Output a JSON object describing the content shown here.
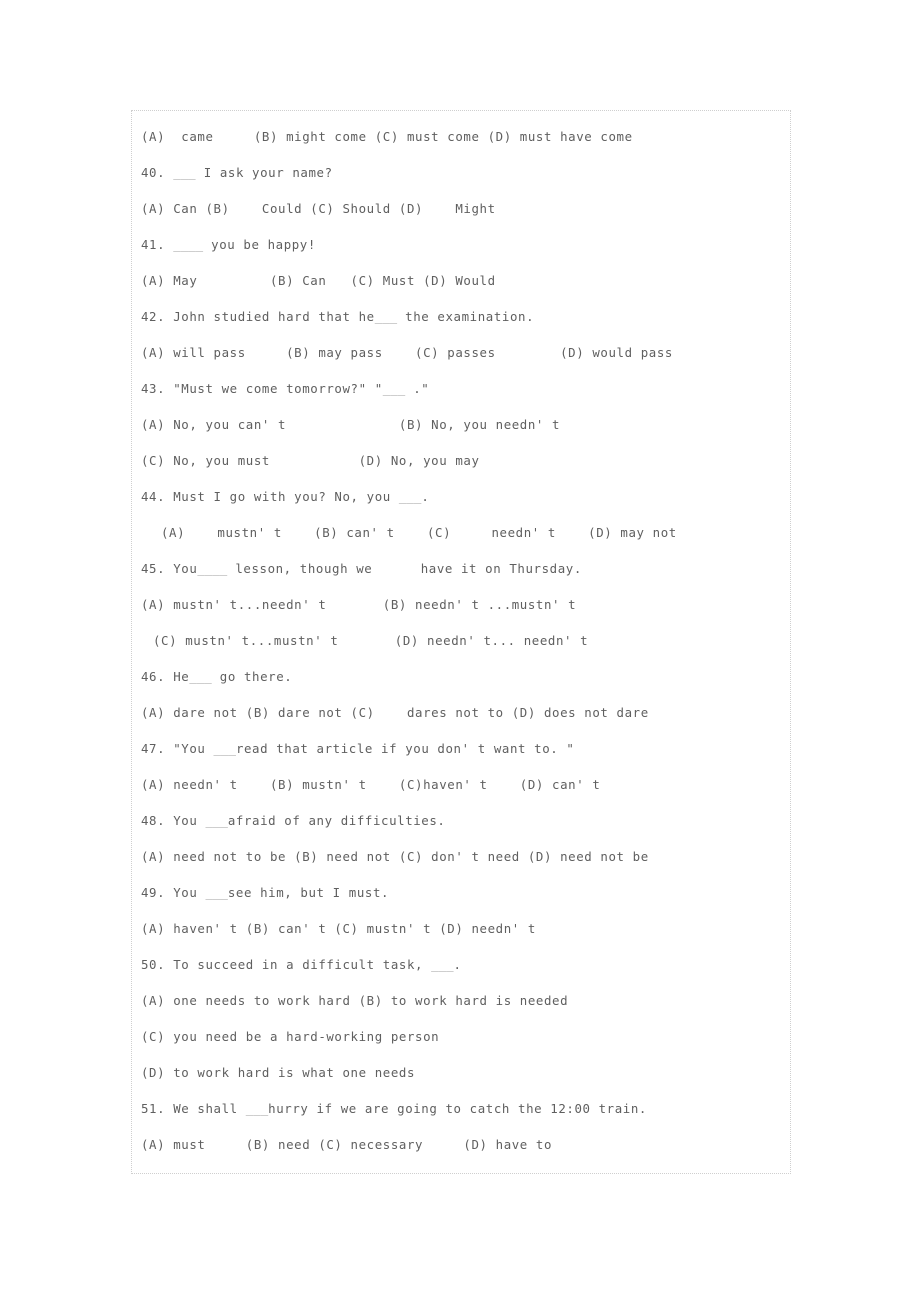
{
  "document": {
    "type": "exam-worksheet",
    "subject": "English grammar multiple choice (modal verbs)",
    "text_color": "#5f5f5f",
    "border_color": "#cfcfcf",
    "background": "#ffffff"
  },
  "lines": [
    {
      "id": "l01",
      "kind": "options",
      "indent": 0,
      "text": "(A)  came     (B) might come (C) must come (D) must have come"
    },
    {
      "id": "l02",
      "kind": "question",
      "indent": 0,
      "text": "40. ___ I ask your name?"
    },
    {
      "id": "l03",
      "kind": "options",
      "indent": 0,
      "text": "(A) Can (B)    Could (C) Should (D)    Might"
    },
    {
      "id": "l04",
      "kind": "question",
      "indent": 0,
      "text": "41. ____ you be happy!"
    },
    {
      "id": "l05",
      "kind": "options",
      "indent": 0,
      "text": "(A) May         (B) Can   (C) Must (D) Would"
    },
    {
      "id": "l06",
      "kind": "question",
      "indent": 0,
      "text": "42. John studied hard that he___ the examination."
    },
    {
      "id": "l07",
      "kind": "options",
      "indent": 0,
      "text": "(A) will pass     (B) may pass    (C) passes        (D) would pass"
    },
    {
      "id": "l08",
      "kind": "question",
      "indent": 0,
      "text": "43. \"Must we come tomorrow?\" \"___ .\""
    },
    {
      "id": "l09",
      "kind": "options",
      "indent": 0,
      "text": "(A) No, you can' t              (B) No, you needn' t"
    },
    {
      "id": "l10",
      "kind": "options",
      "indent": 0,
      "text": "(C) No, you must           (D) No, you may"
    },
    {
      "id": "l11",
      "kind": "question",
      "indent": 0,
      "text": "44. Must I go with you? No, you ___."
    },
    {
      "id": "l12",
      "kind": "options",
      "indent": 1,
      "text": "(A)    mustn' t    (B) can' t    (C)     needn' t    (D) may not"
    },
    {
      "id": "l13",
      "kind": "question",
      "indent": 0,
      "text": "45. You____ lesson, though we      have it on Thursday."
    },
    {
      "id": "l14",
      "kind": "options",
      "indent": 0,
      "text": "(A) mustn' t...needn' t       (B) needn' t ...mustn' t"
    },
    {
      "id": "l15",
      "kind": "options",
      "indent": 2,
      "text": "(C) mustn' t...mustn' t       (D) needn' t... needn' t"
    },
    {
      "id": "l16",
      "kind": "question",
      "indent": 0,
      "text": "46. He___ go there."
    },
    {
      "id": "l17",
      "kind": "options",
      "indent": 0,
      "text": "(A) dare not (B) dare not (C)    dares not to (D) does not dare"
    },
    {
      "id": "l18",
      "kind": "question",
      "indent": 0,
      "text": "47. \"You ___read that article if you don' t want to. \""
    },
    {
      "id": "l19",
      "kind": "options",
      "indent": 0,
      "text": "(A) needn' t    (B) mustn' t    (C)haven' t    (D) can' t"
    },
    {
      "id": "l20",
      "kind": "question",
      "indent": 0,
      "text": "48. You ___afraid of any difficulties."
    },
    {
      "id": "l21",
      "kind": "options",
      "indent": 0,
      "text": "(A) need not to be (B) need not (C) don' t need (D) need not be"
    },
    {
      "id": "l22",
      "kind": "question",
      "indent": 0,
      "text": "49. You ___see him, but I must."
    },
    {
      "id": "l23",
      "kind": "options",
      "indent": 0,
      "text": "(A) haven' t (B) can' t (C) mustn' t (D) needn' t"
    },
    {
      "id": "l24",
      "kind": "question",
      "indent": 0,
      "text": "50. To succeed in a difficult task, ___."
    },
    {
      "id": "l25",
      "kind": "options",
      "indent": 0,
      "text": "(A) one needs to work hard (B) to work hard is needed"
    },
    {
      "id": "l26",
      "kind": "options",
      "indent": 0,
      "text": "(C) you need be a hard-working person"
    },
    {
      "id": "l27",
      "kind": "options",
      "indent": 0,
      "text": "(D) to work hard is what one needs"
    },
    {
      "id": "l28",
      "kind": "question",
      "indent": 0,
      "text": "51. We shall ___hurry if we are going to catch the 12:00 train."
    },
    {
      "id": "l29",
      "kind": "options",
      "indent": 0,
      "text": "(A) must     (B) need (C) necessary     (D) have to"
    }
  ]
}
